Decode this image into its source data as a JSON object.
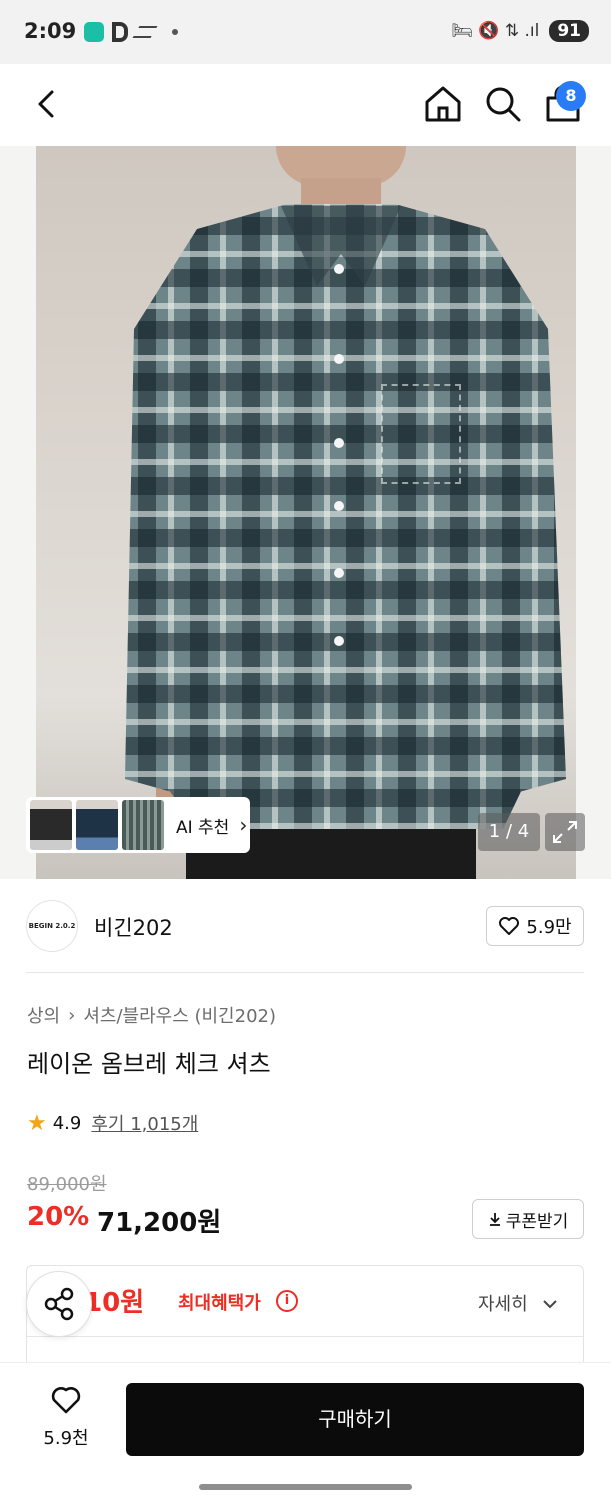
{
  "status_bar": {
    "time": "2:09",
    "battery": "91",
    "system_icons": "🛏 🔇 ⇅ .ıl"
  },
  "nav": {
    "cart_badge": "8"
  },
  "gallery": {
    "ai_label": "AI 추천",
    "counter": "1 / 4"
  },
  "brand": {
    "logo_text": "BEGIN 2.0.2",
    "name": "비긴202",
    "like_count": "5.9만"
  },
  "breadcrumb": {
    "category": "상의",
    "subcategory": "셔츠/블라우스 (비긴202)"
  },
  "product": {
    "title": "레이온 옴브레 체크 셔츠",
    "rating": "4.9",
    "review_label": "후기 1,015개",
    "original_price": "89,000원",
    "discount": "20%",
    "sale_price": "71,200원",
    "coupon_label": "쿠폰받기"
  },
  "benefit": {
    "amount": "910원",
    "label": "최대혜택가",
    "detail_label": "자세히"
  },
  "bottom": {
    "like_count": "5.9천",
    "buy_label": "구매하기"
  },
  "colors": {
    "accent_red": "#ee2e24",
    "badge_blue": "#2a7cf6",
    "buy_black": "#0b0b0b"
  }
}
